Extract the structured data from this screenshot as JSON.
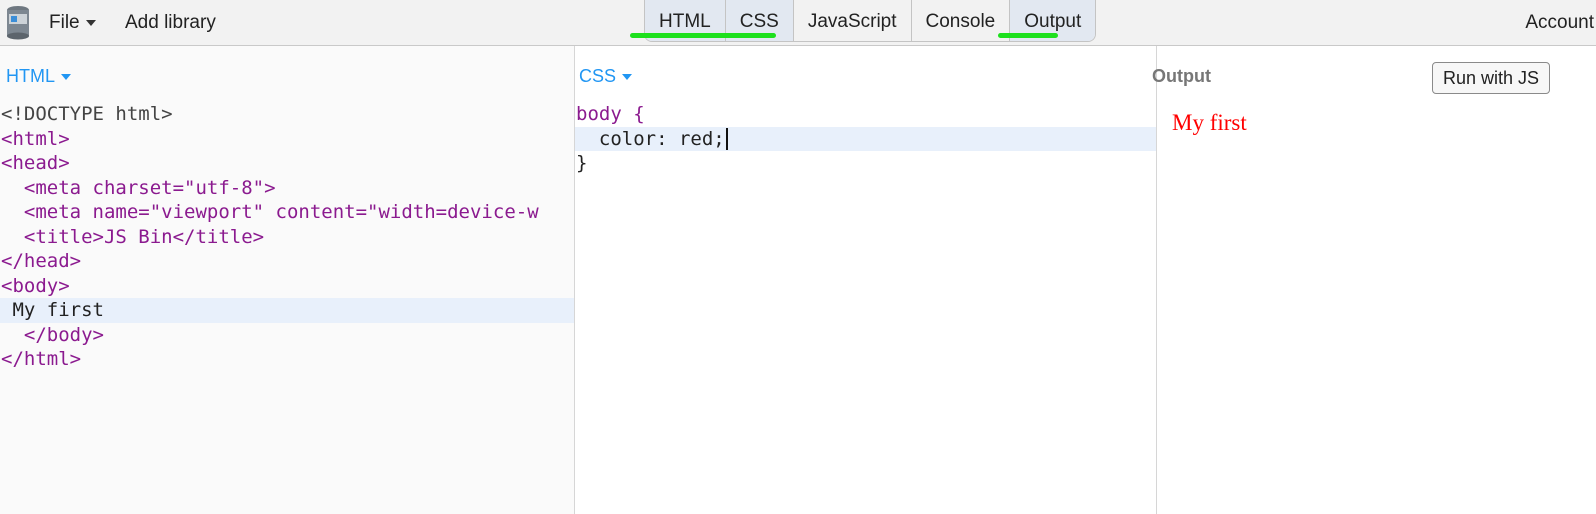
{
  "toolbar": {
    "file_label": "File",
    "add_library_label": "Add library",
    "account_label": "Account",
    "tabs": [
      {
        "label": "HTML",
        "active": true
      },
      {
        "label": "CSS",
        "active": true
      },
      {
        "label": "JavaScript",
        "active": false
      },
      {
        "label": "Console",
        "active": false
      },
      {
        "label": "Output",
        "active": true
      }
    ],
    "logo_icon": "jsbin-logo-icon",
    "active_underline_color": "#1de01d"
  },
  "html_panel": {
    "label": "HTML",
    "lines": [
      "<!DOCTYPE html>",
      "<html>",
      "<head>",
      "  <meta charset=\"utf-8\">",
      "  <meta name=\"viewport\" content=\"width=device-w",
      "  <title>JS Bin</title>",
      "</head>",
      "<body>",
      " My first",
      "  </body>",
      "</html>"
    ]
  },
  "css_panel": {
    "label": "CSS",
    "lines": [
      "body {",
      "  color: red;",
      "}"
    ]
  },
  "output_panel": {
    "label": "Output",
    "run_button_label": "Run with JS",
    "rendered_text": "My first",
    "rendered_text_color": "#ff0000"
  },
  "colors": {
    "accent": "#2196f3",
    "tag": "#8b1a8f",
    "attribute": "#b24b00",
    "string": "#c1121f"
  }
}
